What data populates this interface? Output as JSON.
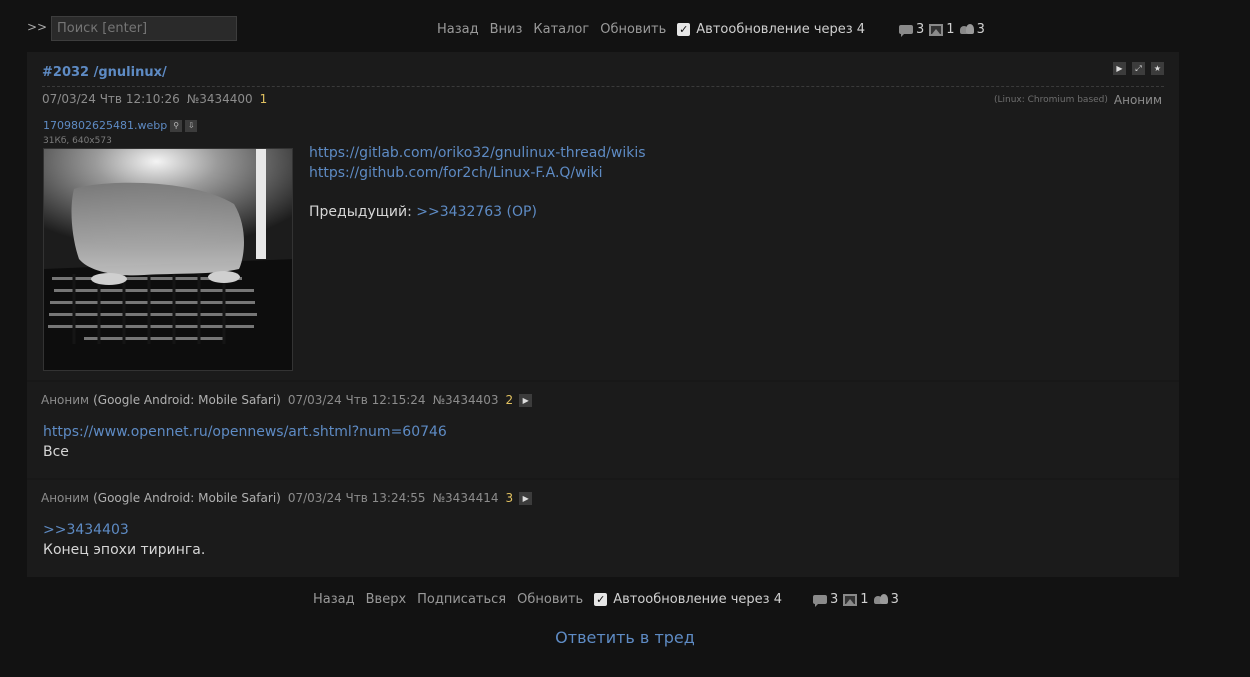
{
  "topbar": {
    "expand_label": ">>",
    "search_placeholder": "Поиск [enter]"
  },
  "nav_top": {
    "links": [
      "Назад",
      "Вниз",
      "Каталог",
      "Обновить"
    ],
    "autoupdate_label": "Автообновление через 4",
    "autoupdate_checked": true
  },
  "nav_bottom": {
    "links": [
      "Назад",
      "Вверх",
      "Подписаться",
      "Обновить"
    ],
    "autoupdate_label": "Автообновление через 4",
    "autoupdate_checked": true
  },
  "stats": {
    "posts": "3",
    "images": "1",
    "posters": "3"
  },
  "op": {
    "title": "#2032 /gnulinux/",
    "date": "07/03/24 Чтв 12:10:26",
    "number": "№3434400",
    "post_index": "1",
    "os": "(Linux: Chromium based)",
    "author": "Аноним",
    "file": {
      "name": "1709802625481.webp",
      "info": "31Кб, 640x573"
    },
    "lines": [
      {
        "text": "https://gitlab.com/oriko32/gnulinux-thread/wikis",
        "type": "link"
      },
      {
        "text": "https://github.com/for2ch/Linux-F.A.Q/wiki",
        "type": "link"
      },
      {
        "text": "",
        "type": "blank"
      },
      {
        "prefix": "Предыдущий: ",
        "text": ">>3432763 (OP)",
        "type": "mixed"
      }
    ]
  },
  "replies": [
    {
      "author": "Аноним",
      "os": "(Google Android: Mobile Safari)",
      "date": "07/03/24 Чтв 12:15:24",
      "number": "№3434403",
      "post_index": "2",
      "link": "https://www.opennet.ru/opennews/art.shtml?num=60746",
      "text": "Все"
    },
    {
      "author": "Аноним",
      "os": "(Google Android: Mobile Safari)",
      "date": "07/03/24 Чтв 13:24:55",
      "number": "№3434414",
      "post_index": "3",
      "link": ">>3434403",
      "text": "Конец эпохи тиринга."
    }
  ],
  "reply_to_thread": "Ответить в тред",
  "colors": {
    "background": "#121212",
    "post_bg": "#1b1b1b",
    "link": "#5e8bc4",
    "post_index": "#e0c060"
  }
}
